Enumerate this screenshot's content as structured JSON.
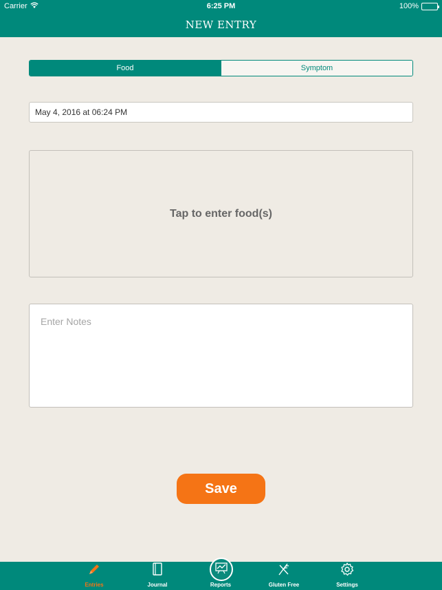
{
  "status_bar": {
    "carrier": "Carrier",
    "time": "6:25 PM",
    "battery": "100%"
  },
  "nav": {
    "title": "NEW ENTRY"
  },
  "segments": {
    "food": "Food",
    "symptom": "Symptom",
    "selected": "Food"
  },
  "entry": {
    "date": "May 4, 2016 at 06:24 PM",
    "food_prompt": "Tap to enter food(s)",
    "notes_placeholder": "Enter Notes",
    "notes_value": ""
  },
  "actions": {
    "save_label": "Save"
  },
  "tabs": [
    {
      "label": "Entries",
      "icon": "pencil-icon",
      "active": true
    },
    {
      "label": "Journal",
      "icon": "journal-icon",
      "active": false
    },
    {
      "label": "Reports",
      "icon": "chart-icon",
      "active": false
    },
    {
      "label": "Gluten Free",
      "icon": "wheat-icon",
      "active": false
    },
    {
      "label": "Settings",
      "icon": "gear-icon",
      "active": false
    }
  ],
  "colors": {
    "primary": "#00897b",
    "accent": "#f57415",
    "background": "#efebe4"
  }
}
